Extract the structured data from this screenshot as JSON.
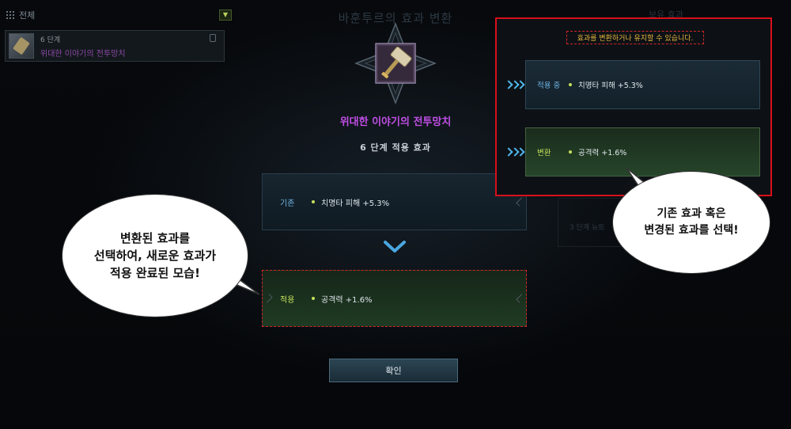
{
  "left_panel": {
    "header_label": "전체",
    "filter_icon": "chevron-down-icon",
    "item": {
      "level": "6 단계",
      "name": "위대한 이야기의 전투망치"
    }
  },
  "dialog": {
    "title": "바훈투르의 효과 변환",
    "item_name": "위대한 이야기의 전투망치",
    "stage_label": "6 단계 적용 효과",
    "current": {
      "tag": "기존",
      "effect": "치명타 피해 +5.3%"
    },
    "applied": {
      "tag": "적용",
      "effect": "공격력 +1.6%"
    },
    "confirm_label": "확인"
  },
  "right_panel_faded": {
    "title": "보유 효과",
    "line": "3 단계  뉴트"
  },
  "popup": {
    "message": "효과를 변환하거나 유지할 수 있습니다.",
    "current": {
      "tag": "적용 중",
      "effect": "치명타 피해 +5.3%"
    },
    "changed": {
      "tag": "변환",
      "effect": "공격력 +1.6%"
    }
  },
  "annotations": {
    "left_line1": "변환된 효과를",
    "left_line2": "선택하여, 새로운 효과가",
    "left_line3": "적용 완료된 모습!",
    "right_line1": "기존 효과 혹은",
    "right_line2": "변경된 효과를 선택!"
  },
  "colors": {
    "item_name": "#c04ee6",
    "current_tag": "#6fb6e6",
    "new_tag": "#c6e05b",
    "highlight_red": "#d8101a",
    "message_gold": "#e4b43b"
  }
}
